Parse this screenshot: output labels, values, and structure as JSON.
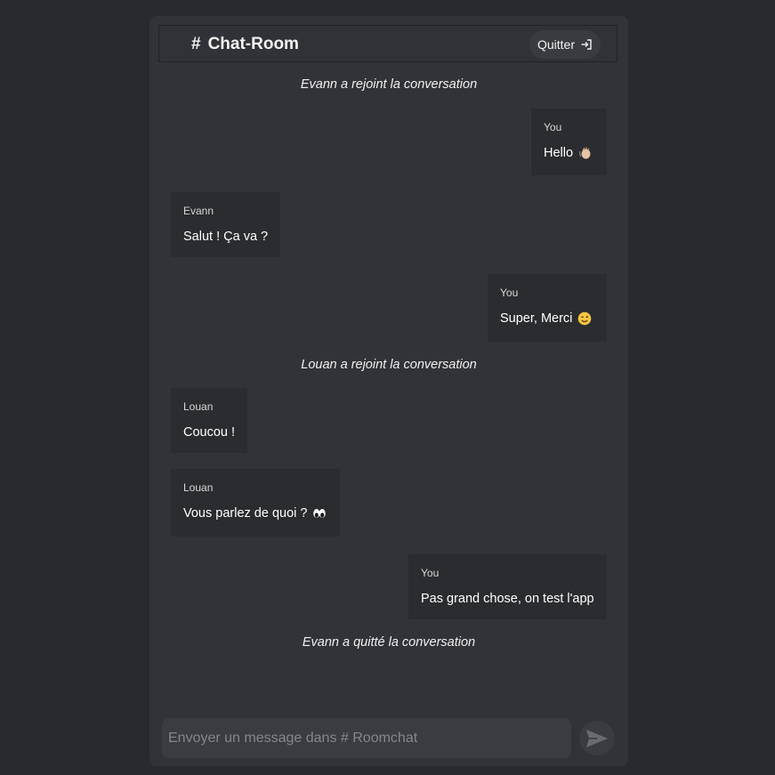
{
  "header": {
    "hash": "#",
    "title": "Chat-Room",
    "quit_label": "Quitter",
    "quit_icon": "sign-out-icon"
  },
  "events": [
    "Evann a rejoint la conversation",
    "Louan a rejoint la conversation",
    "Evann a quitté la conversation"
  ],
  "messages": [
    {
      "author": "You",
      "text": "Hello",
      "emoji": "waving-hand",
      "side": "right"
    },
    {
      "author": "Evann",
      "text": "Salut ! Ça va ?",
      "side": "left"
    },
    {
      "author": "You",
      "text": "Super, Merci",
      "emoji": "winking-face",
      "side": "right"
    },
    {
      "author": "Louan",
      "text": "Coucou !",
      "side": "left"
    },
    {
      "author": "Louan",
      "text": "Vous parlez de quoi ?",
      "emoji": "eyes",
      "side": "left"
    },
    {
      "author": "You",
      "text": "Pas grand chose, on test l'app",
      "side": "right"
    }
  ],
  "composer": {
    "placeholder": "Envoyer un message dans # Roomchat",
    "value": "",
    "send_icon": "send-icon"
  },
  "colors": {
    "page_bg": "#292a2e",
    "panel_bg": "#323338",
    "bubble_bg": "#2b2c30",
    "input_bg": "#3b3c41",
    "text": "#ffffff"
  }
}
